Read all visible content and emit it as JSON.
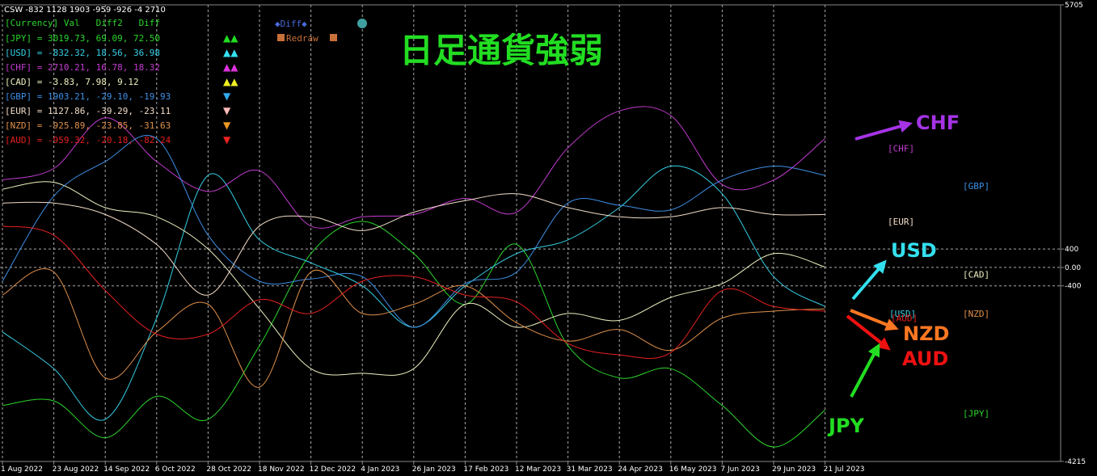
{
  "header": {
    "indicator_line": "CSW -832 1128 1903 -959 -926 -4 2710",
    "table_header": "[Currency] Val   Diff2   Diff",
    "diff_button": "◆Diff◆",
    "redraw_button": "Redraw",
    "title": "日足通貨強弱"
  },
  "currency_table": [
    {
      "currency": "JPY",
      "text": "[JPY] = 3019.73,  69.09,  72.50",
      "arrows": "▲▲",
      "color": "#2bd62b",
      "arrow_color": "#22dd22"
    },
    {
      "currency": "USD",
      "text": "[USD] = -832.32,  18.56,  36.98",
      "arrows": "▲▲",
      "color": "#35d0e6",
      "arrow_color": "#33e0ee"
    },
    {
      "currency": "CHF",
      "text": "[CHF] = 2710.21,  16.78,  18.32",
      "arrows": "▲▲",
      "color": "#c43bd1",
      "arrow_color": "#dd33dd"
    },
    {
      "currency": "CAD",
      "text": "[CAD] =   -3.83,   7.98,   9.12",
      "arrows": "▲▲",
      "color": "#f0f0c0",
      "arrow_color": "#eeee22"
    },
    {
      "currency": "GBP",
      "text": "[GBP] = 1903.21, -29.10, -19.93",
      "arrows": "▼",
      "color": "#3d8fe6",
      "arrow_color": "#33aaee"
    },
    {
      "currency": "EUR",
      "text": "[EUR] = 1127.86, -39.29, -23.11",
      "arrows": "▼",
      "color": "#f2dcc8",
      "arrow_color": "#ffbbbb"
    },
    {
      "currency": "NZD",
      "text": "[NZD] = -925.89, -23.85, -31.63",
      "arrows": "▼",
      "color": "#e0904a",
      "arrow_color": "#ee9922"
    },
    {
      "currency": "AUD",
      "text": "[AUD] = -959.32, -20.18, -82.24",
      "arrows": "▼",
      "color": "#e62020",
      "arrow_color": "#ee2222"
    }
  ],
  "colors": {
    "background": "#000000",
    "grid": "#c8c8c8",
    "axis": "#888888",
    "title": "#22dd22",
    "CHF": "#c43bd1",
    "GBP": "#3d8fe6",
    "EUR": "#f2dcc8",
    "CAD": "#f0f0c0",
    "USD": "#35d0e6",
    "NZD": "#e0904a",
    "AUD": "#e62020",
    "JPY": "#2bd62b"
  },
  "chart_data": {
    "type": "line",
    "title": "日足通貨強弱",
    "x": [
      "1 Aug 2022",
      "23 Aug 2022",
      "14 Sep 2022",
      "6 Oct 2022",
      "28 Oct 2022",
      "18 Nov 2022",
      "12 Dec 2022",
      "4 Jan 2023",
      "26 Jan 2023",
      "17 Feb 2023",
      "12 Mar 2023",
      "31 Mar 2023",
      "24 Apr 2023",
      "16 May 2023",
      "7 Jun 2023",
      "29 Jun 2023",
      "21 Jul 2023"
    ],
    "ylim": [
      -4215,
      5705
    ],
    "yticks": [
      5705,
      400,
      0,
      -400,
      -4215
    ],
    "ytick_labels": [
      "5705",
      "400",
      "0.00",
      "-400",
      "-4215"
    ],
    "hlines": [
      400,
      0,
      -400
    ],
    "series": [
      {
        "name": "JPY",
        "values": [
          -3000,
          -2900,
          -3700,
          -2800,
          -3300,
          -1700,
          300,
          1000,
          300,
          -800,
          500,
          -1700,
          -2400,
          -2200,
          -3000,
          -3900,
          -3100
        ]
      },
      {
        "name": "USD",
        "values": [
          -1400,
          -2200,
          -3300,
          -1100,
          2000,
          600,
          100,
          -400,
          -1300,
          -400,
          300,
          600,
          1300,
          2200,
          1600,
          -200,
          -850
        ]
      },
      {
        "name": "CHF",
        "values": [
          1900,
          2150,
          3250,
          2300,
          1650,
          2100,
          900,
          1100,
          1150,
          1500,
          1200,
          2600,
          3400,
          3300,
          1800,
          1900,
          2800
        ]
      },
      {
        "name": "CAD",
        "values": [
          1700,
          1850,
          1300,
          1100,
          400,
          -900,
          -2200,
          -2300,
          -2200,
          -800,
          -1300,
          -1000,
          -1150,
          -650,
          -350,
          300,
          10
        ]
      },
      {
        "name": "GBP",
        "values": [
          -300,
          1550,
          2300,
          2800,
          700,
          -300,
          -250,
          -200,
          -1300,
          -350,
          -100,
          1400,
          1350,
          1250,
          1900,
          2200,
          2000
        ]
      },
      {
        "name": "EUR",
        "values": [
          1400,
          1400,
          1150,
          500,
          -600,
          900,
          1100,
          800,
          1200,
          1450,
          1600,
          1300,
          1100,
          1100,
          1300,
          1150,
          1150
        ]
      },
      {
        "name": "NZD",
        "values": [
          -600,
          -100,
          -2400,
          -1400,
          -800,
          -2600,
          -100,
          -1000,
          -800,
          -400,
          -1200,
          -1600,
          -1350,
          -1800,
          -1100,
          -950,
          -900
        ]
      },
      {
        "name": "AUD",
        "values": [
          900,
          700,
          -500,
          -1450,
          -1450,
          -700,
          -1000,
          -300,
          -200,
          -600,
          -750,
          -1650,
          -1900,
          -1850,
          -500,
          -850,
          -950
        ]
      }
    ],
    "right_labels": [
      {
        "name": "CHF",
        "text": "[CHF]",
        "value": 2590
      },
      {
        "name": "GBP",
        "text": "[GBP]",
        "value": 1770
      },
      {
        "name": "EUR",
        "text": "[EUR]",
        "value": 1000
      },
      {
        "name": "CAD",
        "text": "[CAD]",
        "value": -150
      },
      {
        "name": "USD",
        "text": "[USD]",
        "value": -1000
      },
      {
        "name": "NZD",
        "text": "[NZD]",
        "value": -1000
      },
      {
        "name": "AUD",
        "text": "[AUD]",
        "value": -1100
      },
      {
        "name": "JPY",
        "text": "[JPY]",
        "value": -3170
      }
    ],
    "annotations": [
      {
        "name": "CHF",
        "text": "CHF",
        "color": "#a633e6"
      },
      {
        "name": "USD",
        "text": "USD",
        "color": "#33e0ee"
      },
      {
        "name": "NZD",
        "text": "NZD",
        "color": "#ff7722"
      },
      {
        "name": "AUD",
        "text": "AUD",
        "color": "#ee1111"
      },
      {
        "name": "JPY",
        "text": "JPY",
        "color": "#22dd22"
      }
    ]
  }
}
